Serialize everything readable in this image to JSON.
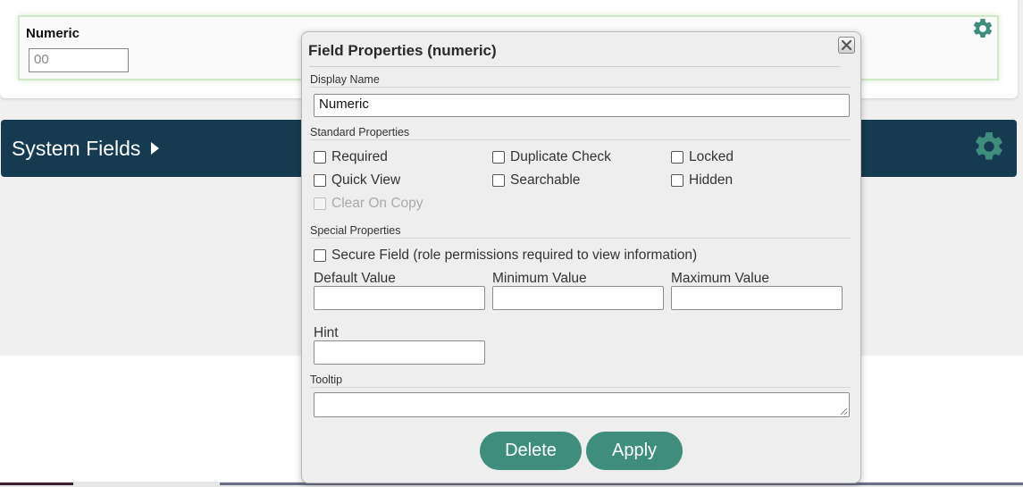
{
  "field": {
    "label": "Numeric",
    "value": "00"
  },
  "system_fields": {
    "title": "System Fields"
  },
  "dialog": {
    "title": "Field Properties (numeric)",
    "display_name_label": "Display Name",
    "display_name_value": "Numeric",
    "standard_label": "Standard Properties",
    "standard": {
      "required": "Required",
      "duplicate_check": "Duplicate Check",
      "locked": "Locked",
      "quick_view": "Quick View",
      "searchable": "Searchable",
      "hidden": "Hidden",
      "clear_on_copy": "Clear On Copy"
    },
    "special_label": "Special Properties",
    "secure_field": "Secure Field (role permissions required to view information)",
    "default_value_label": "Default Value",
    "minimum_value_label": "Minimum Value",
    "maximum_value_label": "Maximum Value",
    "hint_label": "Hint",
    "tooltip_label": "Tooltip",
    "delete_label": "Delete",
    "apply_label": "Apply"
  },
  "colors": {
    "accent": "#3f8d7c",
    "header_bar": "#163a4f"
  }
}
